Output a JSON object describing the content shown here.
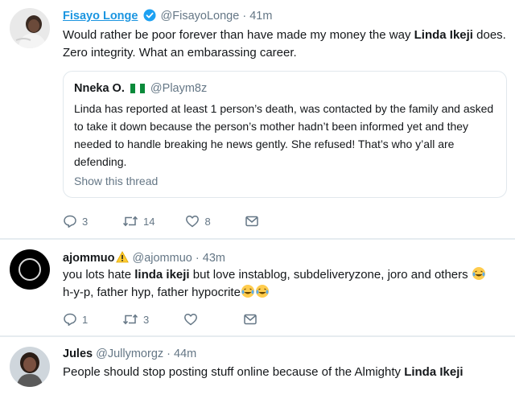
{
  "tweets": [
    {
      "name": "Fisayo Longe",
      "handle": "@FisayoLonge",
      "dot": "·",
      "time": "41m",
      "text_a": "Would rather be poor forever than have made my money the way ",
      "text_b": "Linda Ikeji",
      "text_c": " does. Zero integrity. What an embarassing career.",
      "quote": {
        "name": "Nneka O.",
        "handle": "@Playm8z",
        "text": "Linda has reported at least 1 person’s death, was contacted by the family and asked to take it down because the person’s mother hadn’t been informed yet and they needed to handle breaking he news gently. She refused! That’s who y’all are defending.",
        "show_thread": "Show this thread"
      },
      "replies": "3",
      "retweets": "14",
      "likes": "8"
    },
    {
      "name": "ajommuo",
      "handle": "@ajommuo",
      "dot": "·",
      "time": "43m",
      "text_a": "you lots hate ",
      "text_b": "linda ikeji",
      "text_c": " but love instablog, subdeliveryzone, joro and others ",
      "text_d": "h-y-p, father hyp, father hypocrite",
      "replies": "1",
      "retweets": "3",
      "likes": ""
    },
    {
      "name": "Jules",
      "handle": "@Jullymorgz",
      "dot": "·",
      "time": "44m",
      "text_a": "People should stop posting stuff online because of the Almighty ",
      "text_b": "Linda Ikeji"
    }
  ],
  "icons": {
    "reply": "reply-icon",
    "retweet": "retweet-icon",
    "like": "heart-icon",
    "dm": "envelope-icon",
    "verified": "verified-badge-icon",
    "flag": "nigeria-flag-icon",
    "warning": "warning-icon",
    "emoji": "laughing-tears-emoji-icon"
  },
  "colors": {
    "link": "#1b95e0",
    "muted": "#657786",
    "text": "#14171a",
    "border": "#e1e8ed"
  }
}
